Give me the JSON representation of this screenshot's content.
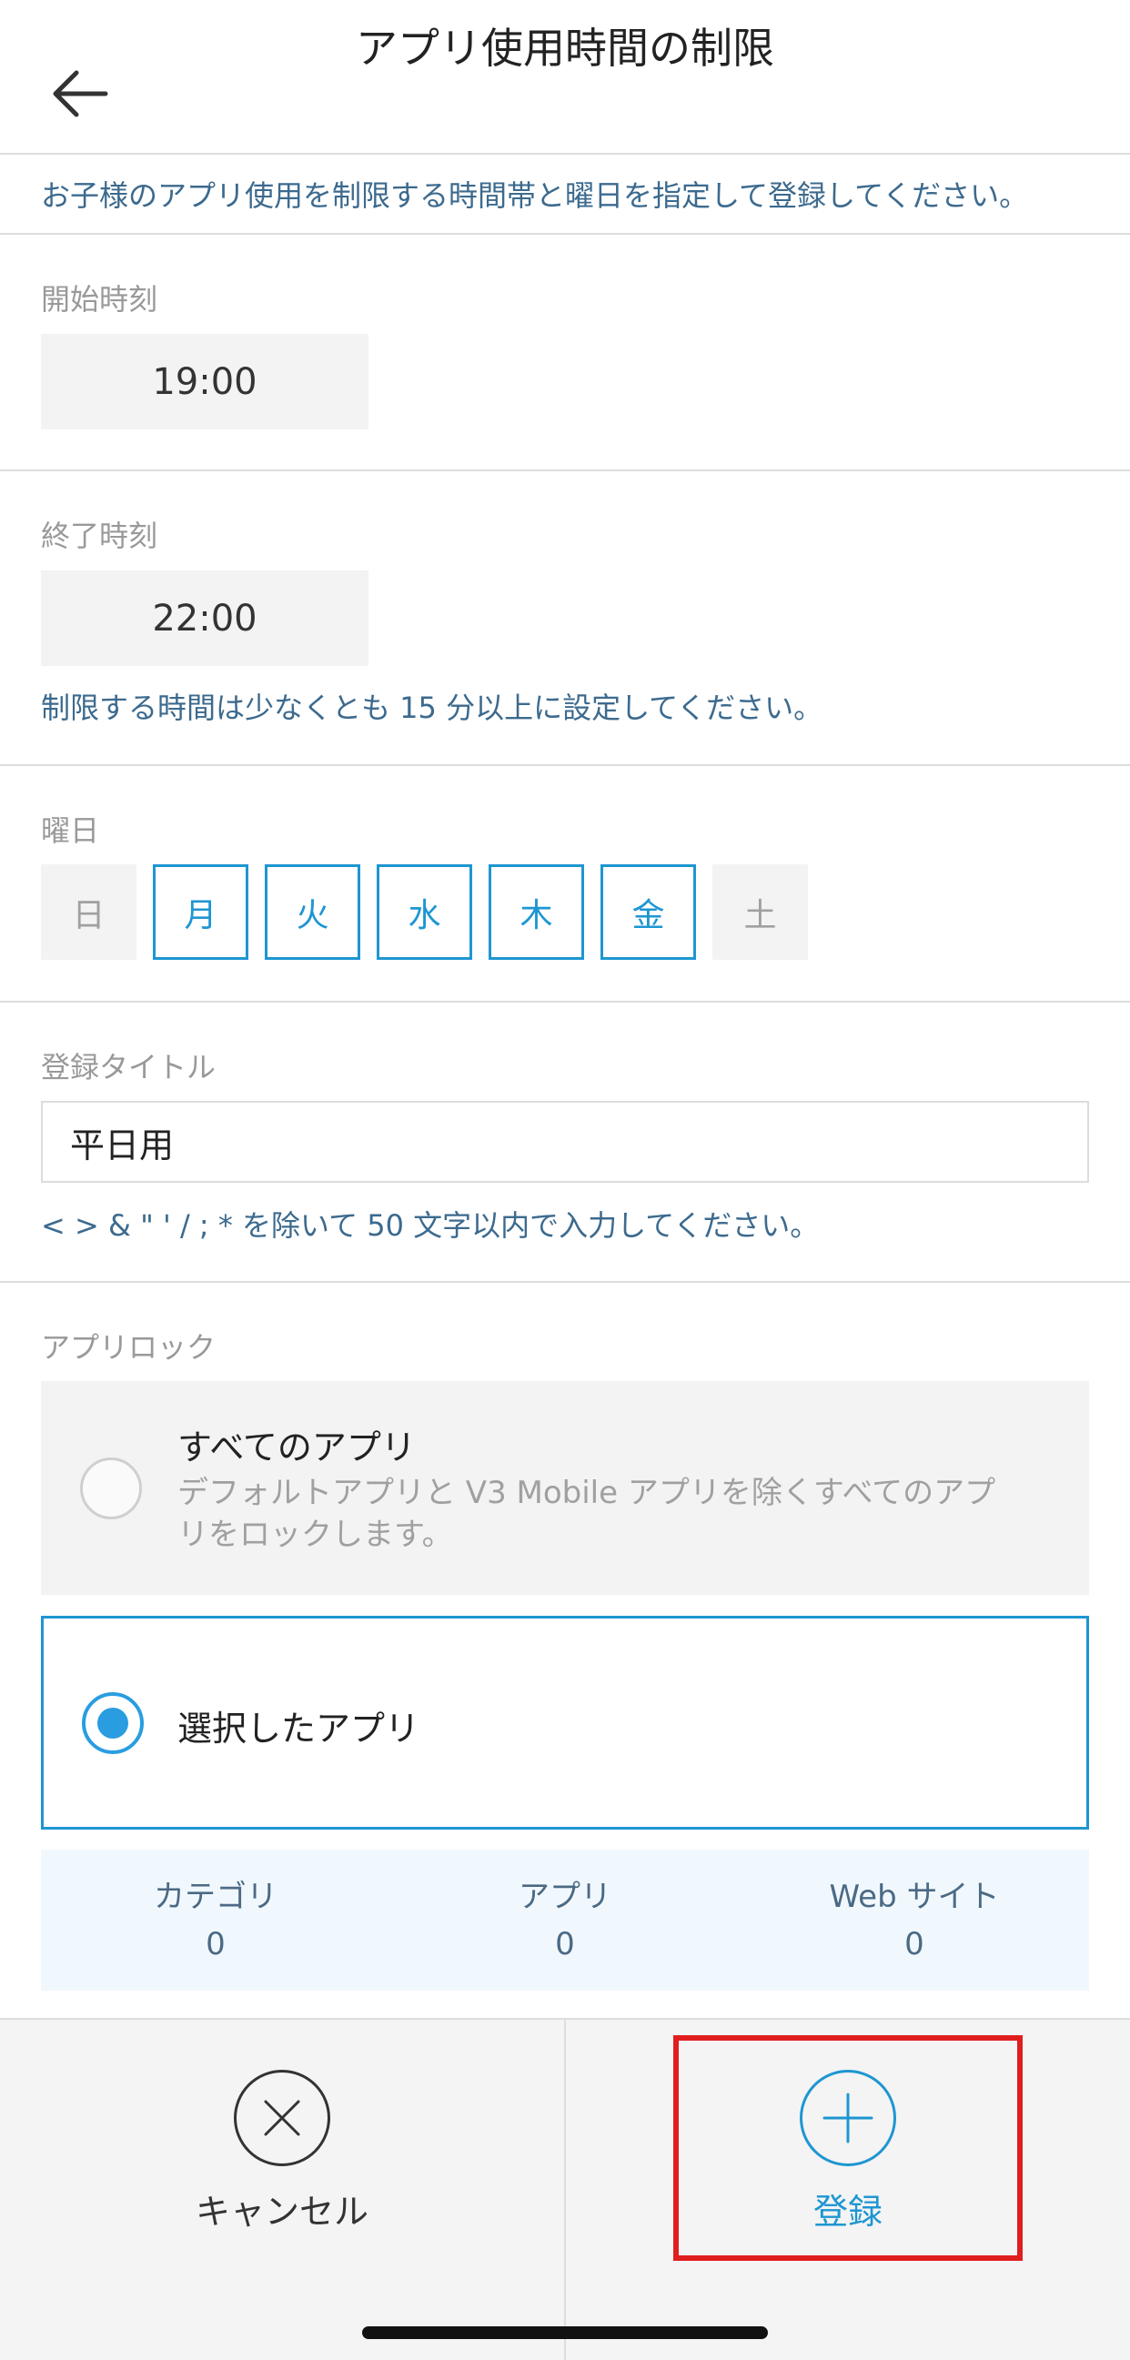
{
  "header": {
    "title": "アプリ使用時間の制限",
    "back_icon": "arrow-left-icon"
  },
  "intro_text": "お子様のアプリ使用を制限する時間帯と曜日を指定して登録してください。",
  "start_time": {
    "label": "開始時刻",
    "value": "19:00"
  },
  "end_time": {
    "label": "終了時刻",
    "value": "22:00",
    "hint": "制限する時間は少なくとも 15 分以上に設定してください。"
  },
  "weekdays": {
    "label": "曜日",
    "days": [
      {
        "label": "日",
        "selected": false
      },
      {
        "label": "月",
        "selected": true
      },
      {
        "label": "火",
        "selected": true
      },
      {
        "label": "水",
        "selected": true
      },
      {
        "label": "木",
        "selected": true
      },
      {
        "label": "金",
        "selected": true
      },
      {
        "label": "土",
        "selected": false
      }
    ]
  },
  "reg_title": {
    "label": "登録タイトル",
    "value": "平日用",
    "hint": "< > & \" ' / ; * を除いて 50 文字以内で入力してください。"
  },
  "app_lock": {
    "label": "アプリロック",
    "options": [
      {
        "title": "すべてのアプリ",
        "description": "デフォルトアプリと V3 Mobile アプリを除くすべてのアプリをロックします。",
        "selected": false
      },
      {
        "title": "選択したアプリ",
        "selected": true
      }
    ],
    "counts": [
      {
        "label": "カテゴリ",
        "value": "0"
      },
      {
        "label": "アプリ",
        "value": "0"
      },
      {
        "label": "Web サイト",
        "value": "0"
      }
    ]
  },
  "footer": {
    "cancel_label": "キャンセル",
    "register_label": "登録",
    "cancel_icon": "close-circle-icon",
    "register_icon": "plus-circle-icon"
  },
  "colors": {
    "accent": "#1e96d2",
    "hint_text": "#3c6a8e",
    "highlight": "#e01e1e",
    "muted": "#999999"
  }
}
